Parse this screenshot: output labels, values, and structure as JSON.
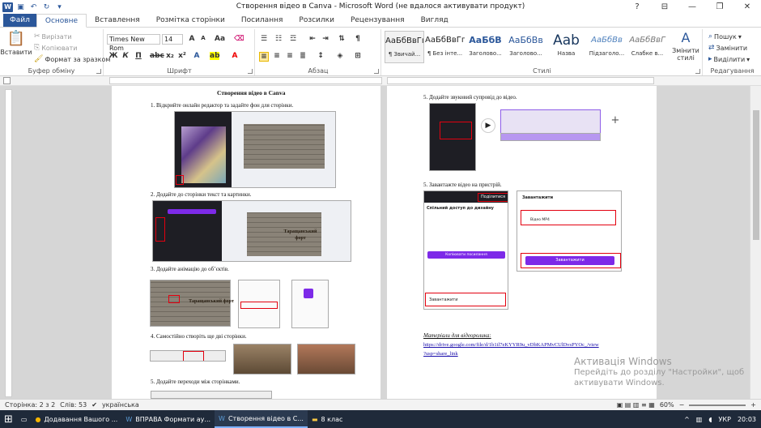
{
  "window": {
    "title": "Створення відео в Canva - Microsoft Word (не вдалося активувати продукт)",
    "controls": [
      "?",
      "⊟",
      "—",
      "❐",
      "✕"
    ]
  },
  "tabs": [
    "Файл",
    "Основне",
    "Вставлення",
    "Розмітка сторінки",
    "Посилання",
    "Розсилки",
    "Рецензування",
    "Вигляд"
  ],
  "ribbon": {
    "clipboard": {
      "paste": "Вставити",
      "cut": "Вирізати",
      "copy": "Копіювати",
      "format_painter": "Формат за зразком",
      "label": "Буфер обміну"
    },
    "font": {
      "name": "Times New Rom",
      "size": "14",
      "label": "Шрифт"
    },
    "paragraph": {
      "label": "Абзац"
    },
    "styles": {
      "items": [
        {
          "preview": "АаБбВвГг,",
          "name": "¶ Звичай..."
        },
        {
          "preview": "АаБбВвГг,",
          "name": "¶ Без інте..."
        },
        {
          "preview": "АаБбВ",
          "name": "Заголово..."
        },
        {
          "preview": "АаБбВв",
          "name": "Заголово..."
        },
        {
          "preview": "Ааb",
          "name": "Назва"
        },
        {
          "preview": "АаБбВв",
          "name": "Підзаголо..."
        },
        {
          "preview": "АаБбВвГ",
          "name": "Слабке в..."
        }
      ],
      "change": "Змінити стилі",
      "label": "Стилі"
    },
    "editing": {
      "find": "Пошук",
      "replace": "Замінити",
      "select": "Виділити",
      "label": "Редагування"
    }
  },
  "document": {
    "left_page": {
      "title": "Створення відео в Canva",
      "steps": [
        "1. Відкрийте  онлайн редактор та задайте фон для сторінки.",
        "2. Додайте до сторінки текст та картинки.",
        "3. Додайте анімацію до об’єктів.",
        "4. Самостійно створіть ще дві сторінки.",
        "5. Додайте переходи між сторінками."
      ],
      "overlay_text": "Таращанський форт"
    },
    "right_page": {
      "steps": [
        "5. Додайте звуковий супровід до відео.",
        "5. Завантажте  відео на пристрій."
      ],
      "materials_label": "Матеріали для відеоролика:",
      "link_line1": "https://drive.google.com/file/d/1b1il7eKYYR9u_vDbKAPMvCUlDvsPYOc_/view",
      "link_line2": "?usp=share_link",
      "share_panel": {
        "title": "Спільний доступ до дизайну",
        "download": "Завантажити",
        "format": "Відео MP4",
        "share_btn": "Поділитися",
        "publish": "Копіювати посилання"
      }
    }
  },
  "watermark": {
    "line1": "Активація Windows",
    "line2": "Перейдіть до розділу \"Настройки\", щоб",
    "line3": "активувати Windows."
  },
  "status": {
    "page": "Сторінка: 2 з 2",
    "words": "Слів: 53",
    "lang": "українська",
    "zoom": "60%"
  },
  "taskbar": {
    "items": [
      "Додавання Вашого ...",
      "ВПРАВА Формати ау...",
      "Створення відео в С...",
      "8 клас"
    ],
    "lang": "УКР",
    "time": "20:03"
  }
}
